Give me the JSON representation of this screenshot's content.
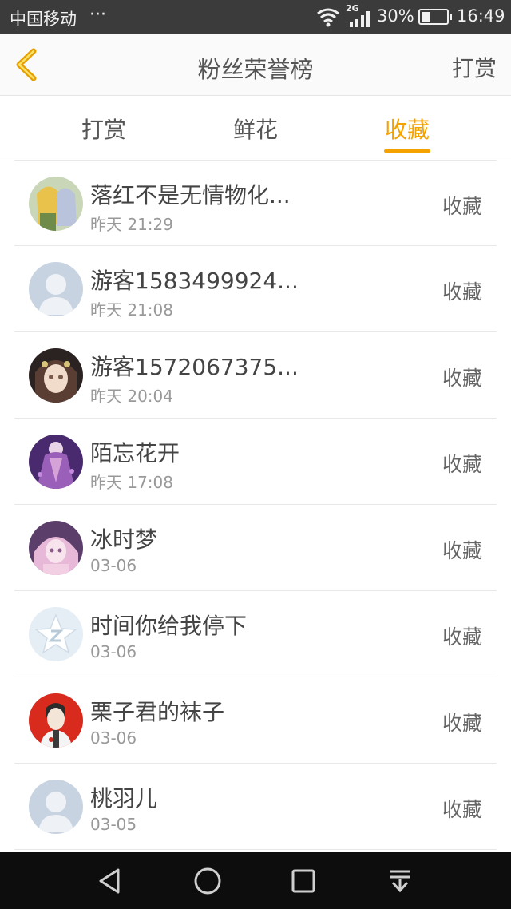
{
  "status_bar": {
    "carrier": "中国移动",
    "dots": "···",
    "network": "2G",
    "battery_percent": "30%",
    "time": "16:49"
  },
  "header": {
    "title": "粉丝荣誉榜",
    "action_label": "打赏",
    "back_icon": "chevron-left-icon"
  },
  "tabs": [
    {
      "label": "打赏"
    },
    {
      "label": "鲜花"
    },
    {
      "label": "收藏"
    }
  ],
  "active_tab": 2,
  "colors": {
    "accent": "#f5a200",
    "status_bar": "#3b3b3b",
    "nav_bar": "#0d0d0d"
  },
  "fans": [
    {
      "name": "落红不是无情物化...",
      "time": "昨天 21:29",
      "action": "收藏",
      "avatar": "anime-avatar"
    },
    {
      "name": "游客1583499924...",
      "time": "昨天 21:08",
      "action": "收藏",
      "avatar": "default-avatar"
    },
    {
      "name": "游客1572067375...",
      "time": "昨天 20:04",
      "action": "收藏",
      "avatar": "anime-avatar"
    },
    {
      "name": "陌忘花开",
      "time": "昨天 17:08",
      "action": "收藏",
      "avatar": "anime-avatar"
    },
    {
      "name": "冰时梦",
      "time": "03-06",
      "action": "收藏",
      "avatar": "anime-avatar"
    },
    {
      "name": "时间你给我停下",
      "time": "03-06",
      "action": "收藏",
      "avatar": "qq-star-avatar"
    },
    {
      "name": "栗子君的袜子",
      "time": "03-06",
      "action": "收藏",
      "avatar": "illustrated-avatar"
    },
    {
      "name": "桃羽儿",
      "time": "03-05",
      "action": "收藏",
      "avatar": "default-avatar"
    }
  ]
}
